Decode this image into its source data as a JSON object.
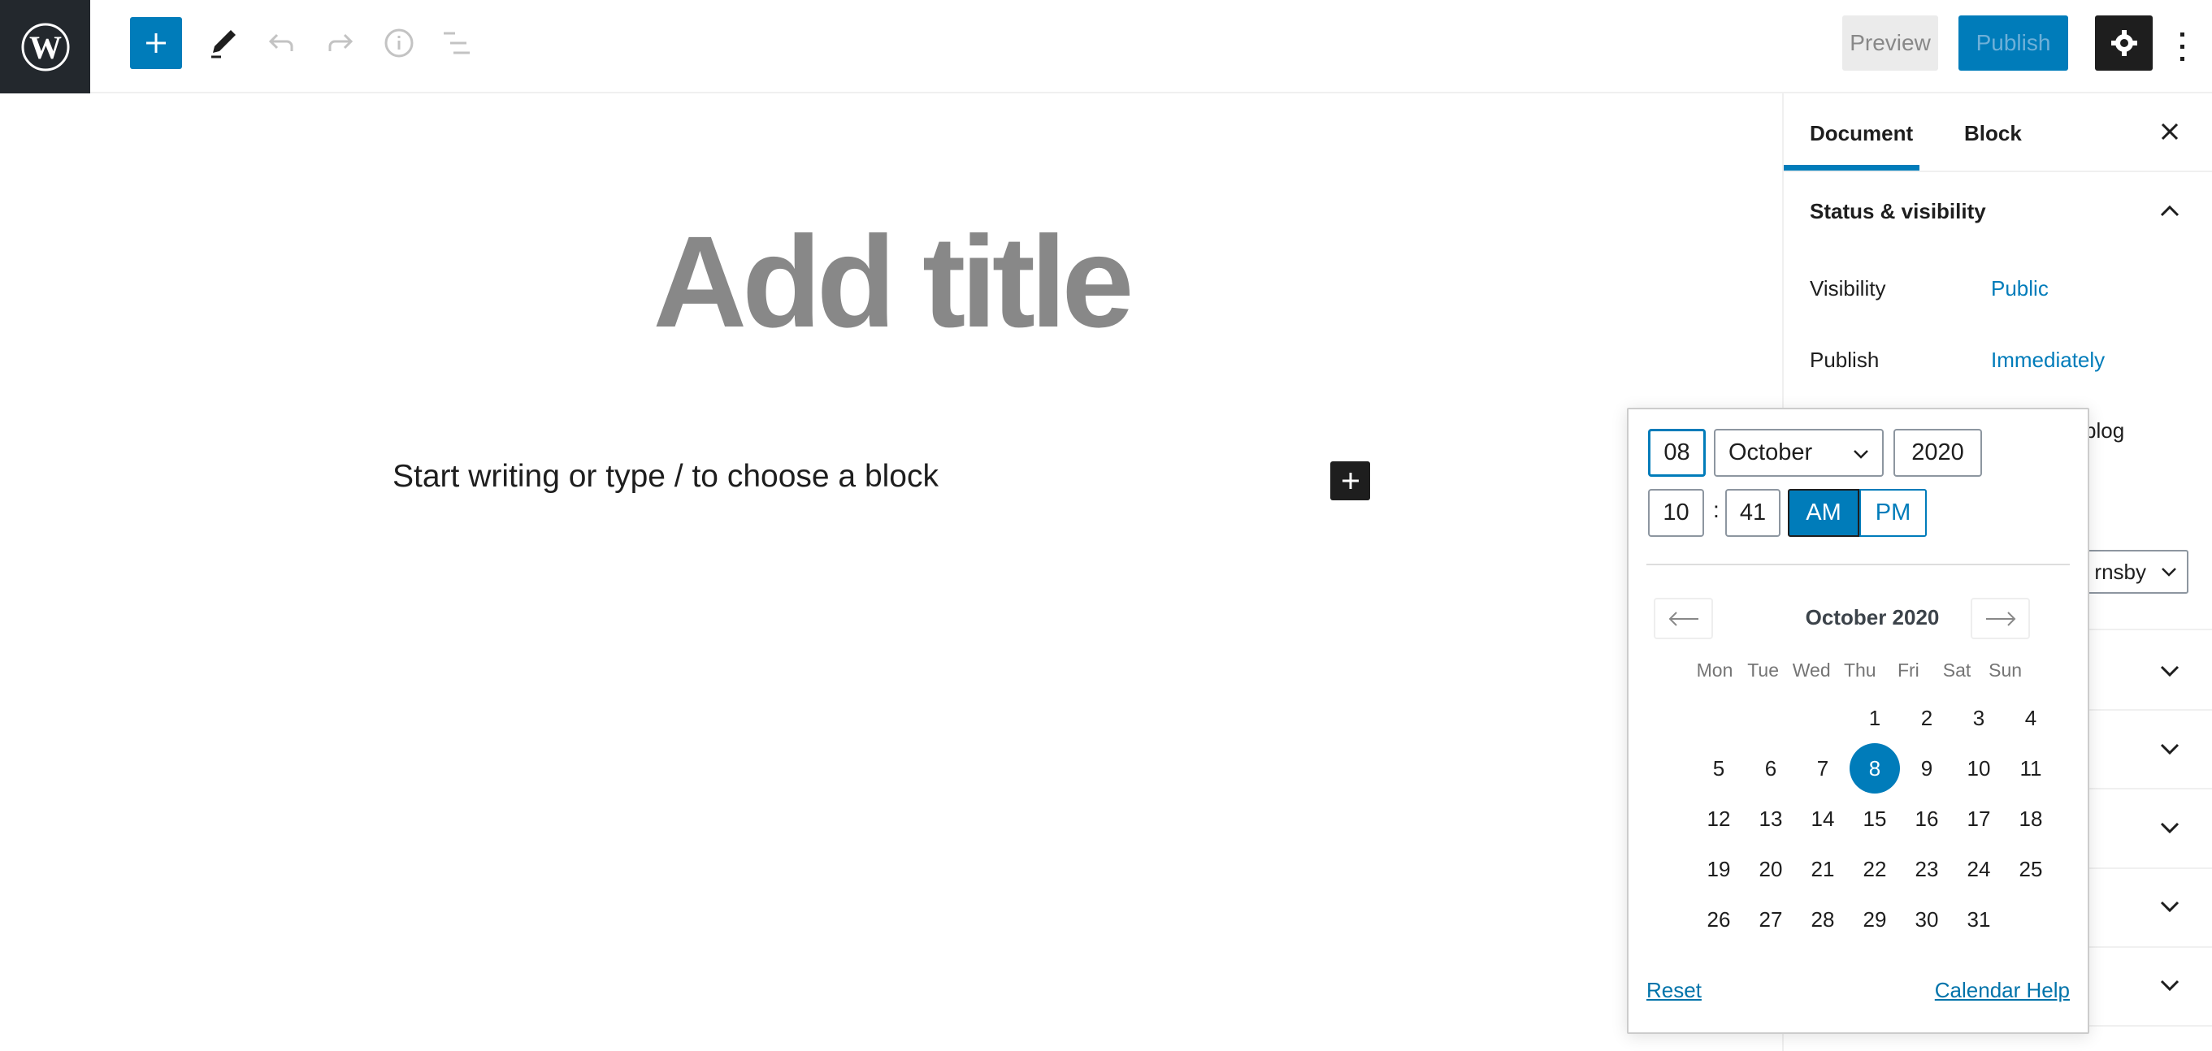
{
  "header": {
    "preview_label": "Preview",
    "publish_label": "Publish",
    "icons": [
      "wordpress-logo",
      "plus-icon",
      "pencil-icon",
      "undo-icon",
      "redo-icon",
      "info-icon",
      "list-view-icon",
      "gear-icon",
      "more-vertical-icon"
    ]
  },
  "editor": {
    "title_placeholder": "Add title",
    "paragraph_placeholder": "Start writing or type / to choose a block"
  },
  "sidebar": {
    "tabs": [
      {
        "label": "Document",
        "active": true
      },
      {
        "label": "Block",
        "active": false
      }
    ],
    "panel_title": "Status & visibility",
    "rows": [
      {
        "label": "Visibility",
        "value": "Public"
      },
      {
        "label": "Publish",
        "value": "Immediately"
      }
    ],
    "obscured_text": "blog",
    "author_select_visible": "rnsby"
  },
  "datepicker": {
    "day": "08",
    "month": "October",
    "year": "2020",
    "hour": "10",
    "minute": "41",
    "am_label": "AM",
    "pm_label": "PM",
    "selected_period": "AM",
    "month_title": "October 2020",
    "weekdays": [
      "Mon",
      "Tue",
      "Wed",
      "Thu",
      "Fri",
      "Sat",
      "Sun"
    ],
    "weeks": [
      [
        "",
        "",
        "",
        "1",
        "2",
        "3",
        "4"
      ],
      [
        "5",
        "6",
        "7",
        "8",
        "9",
        "10",
        "11"
      ],
      [
        "12",
        "13",
        "14",
        "15",
        "16",
        "17",
        "18"
      ],
      [
        "19",
        "20",
        "21",
        "22",
        "23",
        "24",
        "25"
      ],
      [
        "26",
        "27",
        "28",
        "29",
        "30",
        "31",
        ""
      ]
    ],
    "selected_day": "8",
    "reset_label": "Reset",
    "help_label": "Calendar Help"
  },
  "colors": {
    "accent": "#007cba",
    "dark": "#1e1e1e",
    "logo_bg": "#23282d"
  }
}
